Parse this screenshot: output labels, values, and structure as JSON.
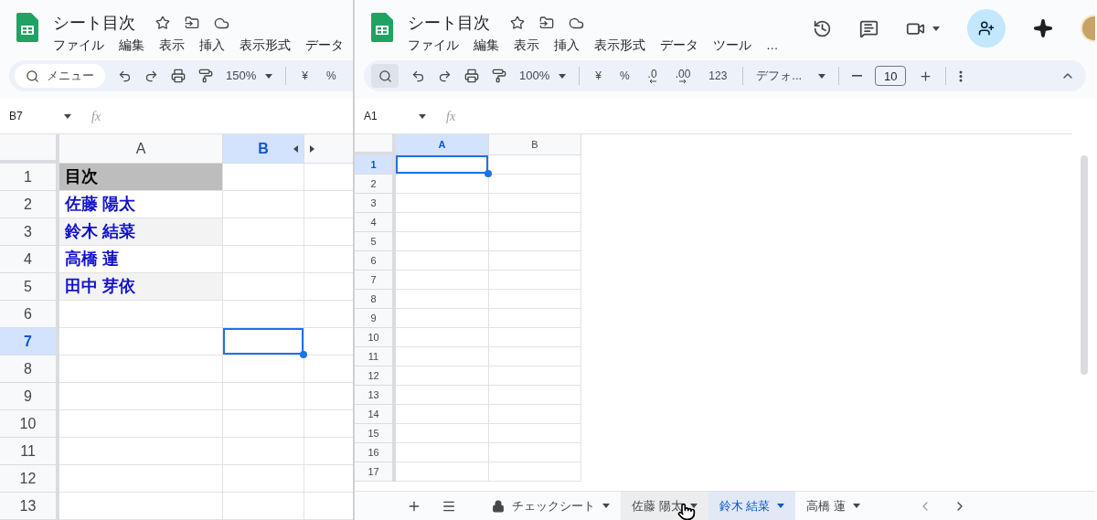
{
  "windows": [
    {
      "kind": "zoomed",
      "title": "シート目次",
      "menu": [
        "ファイル",
        "編集",
        "表示",
        "挿入",
        "表示形式",
        "データ"
      ],
      "toolbar": {
        "search_label": "メニュー",
        "zoom": "150%",
        "number_formats": [
          "¥",
          "%"
        ]
      },
      "name_box": "B7",
      "formula_label": "fx",
      "columns": [
        {
          "label": "A",
          "selected": false
        },
        {
          "label": "B",
          "selected": true
        }
      ],
      "rows": [
        {
          "label": "1",
          "selected": false,
          "banded": false,
          "cells": [
            {
              "kind": "heading",
              "text": "目次",
              "selected": false
            },
            {
              "selected": false
            }
          ]
        },
        {
          "label": "2",
          "selected": false,
          "banded": false,
          "cells": [
            {
              "kind": "link",
              "text": "佐藤 陽太",
              "selected": false
            },
            {
              "selected": false
            }
          ]
        },
        {
          "label": "3",
          "selected": false,
          "banded": true,
          "cells": [
            {
              "kind": "link",
              "text": "鈴木 結菜",
              "selected": false
            },
            {
              "selected": false
            }
          ]
        },
        {
          "label": "4",
          "selected": false,
          "banded": false,
          "cells": [
            {
              "kind": "link",
              "text": "高橋 蓮",
              "selected": false
            },
            {
              "selected": false
            }
          ]
        },
        {
          "label": "5",
          "selected": false,
          "banded": true,
          "cells": [
            {
              "kind": "link",
              "text": "田中 芽依",
              "selected": false
            },
            {
              "selected": false
            }
          ]
        },
        {
          "label": "6",
          "selected": false,
          "banded": false,
          "cells": [
            {
              "selected": false
            },
            {
              "selected": false
            }
          ]
        },
        {
          "label": "7",
          "selected": true,
          "banded": false,
          "cells": [
            {
              "selected": false
            },
            {
              "selected": true
            }
          ]
        },
        {
          "label": "8",
          "selected": false,
          "banded": false,
          "cells": [
            {
              "selected": false
            },
            {
              "selected": false
            }
          ]
        },
        {
          "label": "9",
          "selected": false,
          "banded": false,
          "cells": [
            {
              "selected": false
            },
            {
              "selected": false
            }
          ]
        },
        {
          "label": "10",
          "selected": false,
          "banded": false,
          "cells": [
            {
              "selected": false
            },
            {
              "selected": false
            }
          ]
        },
        {
          "label": "11",
          "selected": false,
          "banded": false,
          "cells": [
            {
              "selected": false
            },
            {
              "selected": false
            }
          ]
        },
        {
          "label": "12",
          "selected": false,
          "banded": false,
          "cells": [
            {
              "selected": false
            },
            {
              "selected": false
            }
          ]
        },
        {
          "label": "13",
          "selected": false,
          "banded": false,
          "cells": [
            {
              "selected": false
            },
            {
              "selected": false
            }
          ]
        }
      ]
    },
    {
      "kind": "full",
      "title": "シート目次",
      "menu": [
        "ファイル",
        "編集",
        "表示",
        "挿入",
        "表示形式",
        "データ",
        "ツール",
        "…"
      ],
      "toolbar": {
        "zoom": "100%",
        "number_formats": [
          "¥",
          "%",
          ".0",
          ".00",
          "123"
        ],
        "font": "デフォ...",
        "font_size": "10"
      },
      "name_box": "A1",
      "formula_label": "fx",
      "columns": [
        {
          "label": "A",
          "selected": true
        },
        {
          "label": "B",
          "selected": false
        }
      ],
      "rows": [
        {
          "label": "1",
          "selected": true,
          "cells": [
            {
              "selected": true
            },
            {
              "selected": false
            }
          ]
        },
        {
          "label": "2",
          "selected": false,
          "cells": [
            {
              "selected": false
            },
            {
              "selected": false
            }
          ]
        },
        {
          "label": "3",
          "selected": false,
          "cells": [
            {
              "selected": false
            },
            {
              "selected": false
            }
          ]
        },
        {
          "label": "4",
          "selected": false,
          "cells": [
            {
              "selected": false
            },
            {
              "selected": false
            }
          ]
        },
        {
          "label": "5",
          "selected": false,
          "cells": [
            {
              "selected": false
            },
            {
              "selected": false
            }
          ]
        },
        {
          "label": "6",
          "selected": false,
          "cells": [
            {
              "selected": false
            },
            {
              "selected": false
            }
          ]
        },
        {
          "label": "7",
          "selected": false,
          "cells": [
            {
              "selected": false
            },
            {
              "selected": false
            }
          ]
        },
        {
          "label": "8",
          "selected": false,
          "cells": [
            {
              "selected": false
            },
            {
              "selected": false
            }
          ]
        },
        {
          "label": "9",
          "selected": false,
          "cells": [
            {
              "selected": false
            },
            {
              "selected": false
            }
          ]
        },
        {
          "label": "10",
          "selected": false,
          "cells": [
            {
              "selected": false
            },
            {
              "selected": false
            }
          ]
        },
        {
          "label": "11",
          "selected": false,
          "cells": [
            {
              "selected": false
            },
            {
              "selected": false
            }
          ]
        },
        {
          "label": "12",
          "selected": false,
          "cells": [
            {
              "selected": false
            },
            {
              "selected": false
            }
          ]
        },
        {
          "label": "13",
          "selected": false,
          "cells": [
            {
              "selected": false
            },
            {
              "selected": false
            }
          ]
        },
        {
          "label": "14",
          "selected": false,
          "cells": [
            {
              "selected": false
            },
            {
              "selected": false
            }
          ]
        },
        {
          "label": "15",
          "selected": false,
          "cells": [
            {
              "selected": false
            },
            {
              "selected": false
            }
          ]
        },
        {
          "label": "16",
          "selected": false,
          "cells": [
            {
              "selected": false
            },
            {
              "selected": false
            }
          ]
        },
        {
          "label": "17",
          "selected": false,
          "cells": [
            {
              "selected": false
            },
            {
              "selected": false
            }
          ]
        }
      ],
      "sheet_tabs": [
        {
          "label": "チェックシート",
          "locked": true,
          "selected": false,
          "hovered": false
        },
        {
          "label": "佐藤 陽太",
          "locked": false,
          "selected": false,
          "hovered": true
        },
        {
          "label": "鈴木 結菜",
          "locked": false,
          "selected": true,
          "hovered": false
        },
        {
          "label": "高橋 蓮",
          "locked": false,
          "selected": false,
          "hovered": false
        }
      ]
    }
  ]
}
